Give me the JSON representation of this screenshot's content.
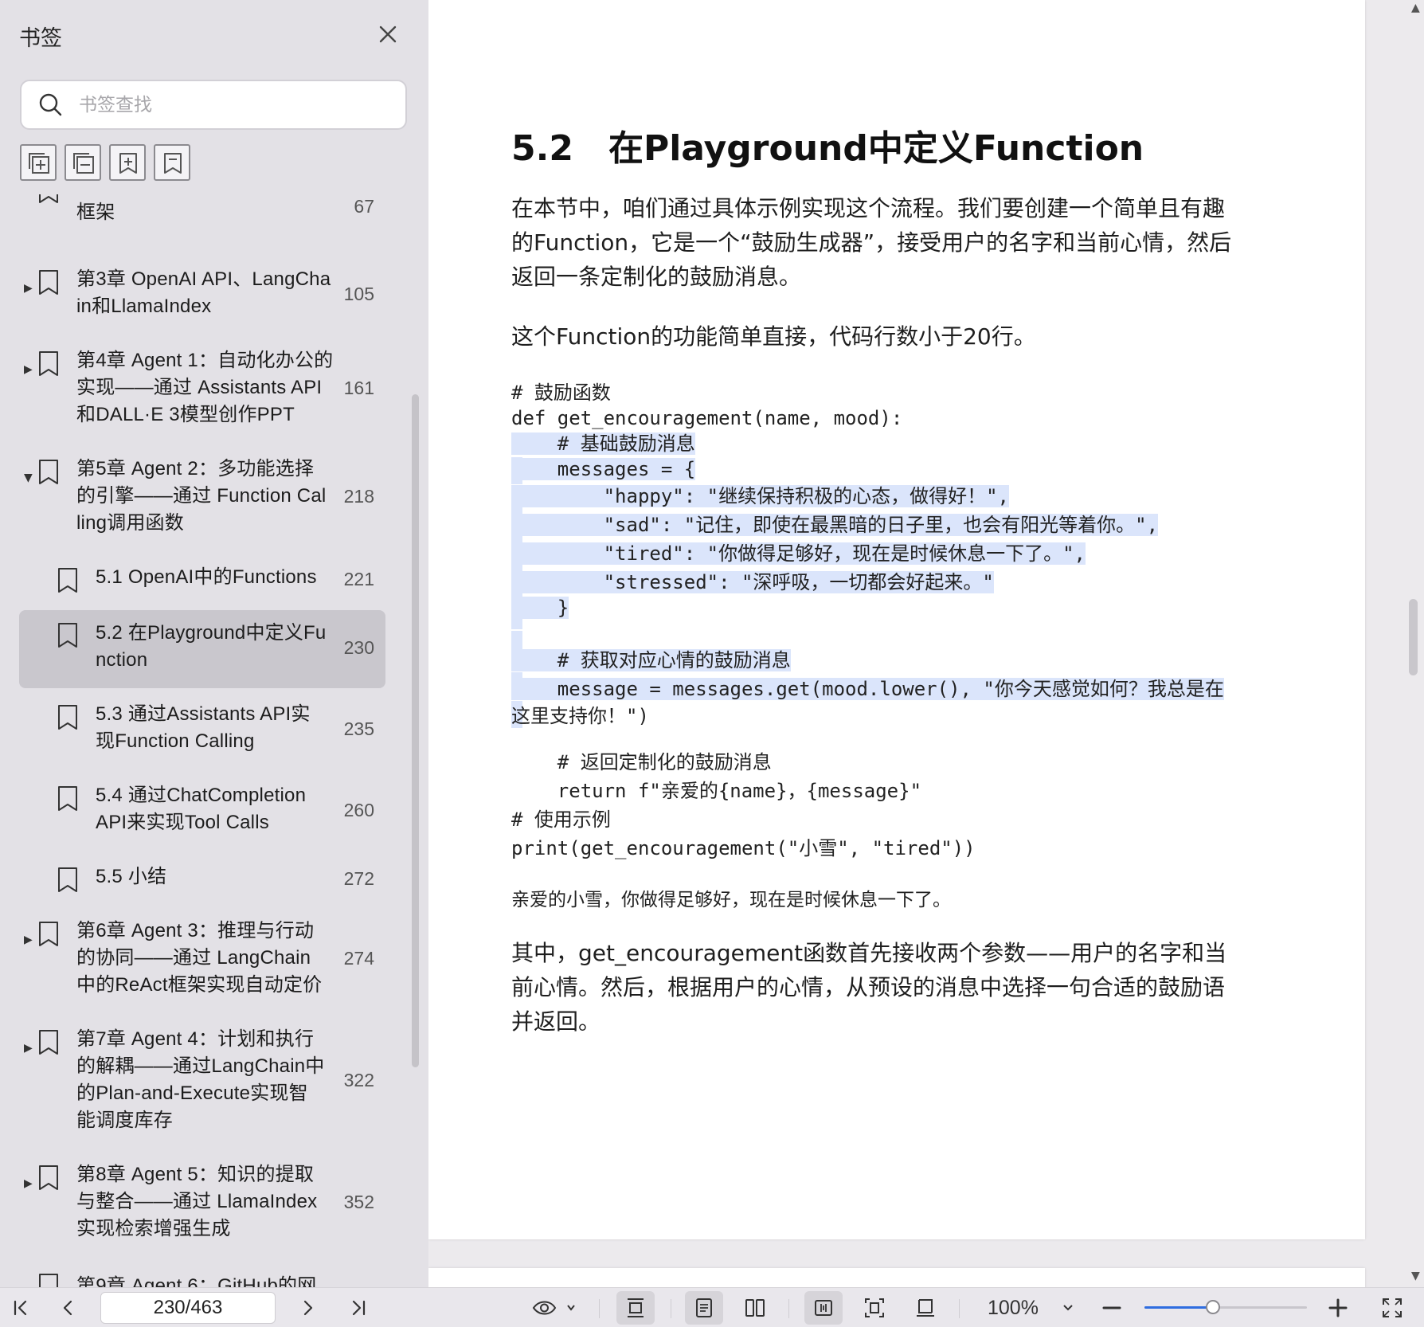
{
  "sidebar": {
    "title": "书签",
    "search_placeholder": "书签查找",
    "tools": [
      "expand-all-icon",
      "collapse-all-icon",
      "add-bookmark-icon",
      "bookmark-icon"
    ],
    "items": [
      {
        "label": "框架",
        "page": "67"
      },
      {
        "label": "第3章 OpenAI API、LangCha\nin和LlamaIndex",
        "page": "105",
        "expandable": true
      },
      {
        "label": "第4章 Agent 1：自动化办公的\n实现——通过 Assistants API\n和DALL·E 3模型创作PPT",
        "page": "161",
        "expandable": true
      },
      {
        "label": "第5章 Agent 2：多功能选择\n的引擎——通过 Function Cal\nling调用函数",
        "page": "218",
        "expanded": true
      },
      {
        "label": "5.1 OpenAI中的Functions",
        "page": "221"
      },
      {
        "label": "5.2 在Playground中定义Fu\nnction",
        "page": "230",
        "selected": true
      },
      {
        "label": "5.3 通过Assistants API实\n现Function Calling",
        "page": "235"
      },
      {
        "label": "5.4 通过ChatCompletion\nAPI来实现Tool Calls",
        "page": "260"
      },
      {
        "label": "5.5 小结",
        "page": "272"
      },
      {
        "label": "第6章 Agent 3：推理与行动\n的协同——通过 LangChain\n中的ReAct框架实现自动定价",
        "page": "274",
        "expandable": true
      },
      {
        "label": "第7章 Agent 4：计划和执行\n的解耦——通过LangChain中\n的Plan-and-Execute实现智\n能调度库存",
        "page": "322",
        "expandable": true
      },
      {
        "label": "第8章 Agent 5：知识的提取\n与整合——通过 LlamaIndex\n实现检索增强生成",
        "page": "352",
        "expandable": true
      },
      {
        "label": "第9章 Agent 6：GitHub的网",
        "page": "",
        "expandable": true
      }
    ]
  },
  "document": {
    "heading": "5.2　在Playground中定义Function",
    "para1": "在本节中，咱们通过具体示例实现这个流程。我们要创建一个简单且有趣的Function，它是一个“鼓励生成器”，接受用户的名字和当前心情，然后返回一条定制化的鼓励消息。",
    "para2": "这个Function的功能简单直接，代码行数小于20行。",
    "code": [
      "# 鼓励函数",
      "def get_encouragement(name, mood):",
      "    # 基础鼓励消息",
      "    messages = {",
      "        \"happy\": \"继续保持积极的心态，做得好！\",",
      "        \"sad\": \"记住，即使在最黑暗的日子里，也会有阳光等着你。\",",
      "        \"tired\": \"你做得足够好，现在是时候休息一下了。\",",
      "        \"stressed\": \"深呼吸，一切都会好起来。\"",
      "    }",
      "",
      "    # 获取对应心情的鼓励消息",
      "    message = messages.get(mood.lower(), \"你今天感觉如何？我总是在",
      "这里支持你！\")",
      "",
      "    # 返回定制化的鼓励消息",
      "    return f\"亲爱的{name}，{message}\"",
      "# 使用示例",
      "print(get_encouragement(\"小雪\", \"tired\"))"
    ],
    "output": "亲爱的小雪，你做得足够好，现在是时候休息一下了。",
    "para3": "其中，get_encouragement函数首先接收两个参数——用户的名字和当前心情。然后，根据用户的心情，从预设的消息中选择一句合适的鼓励语并返回。"
  },
  "toolbar": {
    "page_value": "230/463",
    "zoom_label": "100%",
    "zoom_fraction": 0.42
  },
  "colors": {
    "accent": "#2f6de0",
    "selection": "#dbe5fb",
    "sidebar_bg": "#e3e1e6",
    "selected_item": "#c9c7cd"
  }
}
